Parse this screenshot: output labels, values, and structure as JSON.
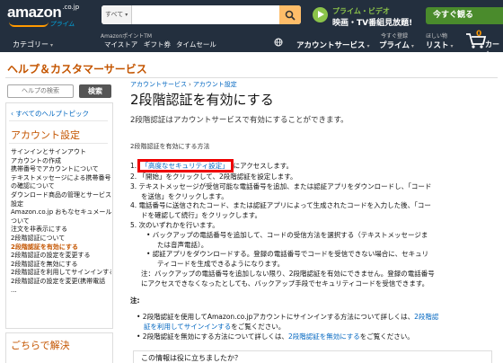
{
  "nav": {
    "logo_text": "amazon",
    "logo_suffix": ".co.jp",
    "logo_sub": "プライム",
    "search_dept": "すべて",
    "search_placeholder": "",
    "prime_video_top": "プライム・ビデオ",
    "prime_video_bottom": "映画・TV番組見放題!",
    "try_button": "今すぐ観る",
    "category_label": "カテゴリー",
    "pointcard_line": "AmazonポイントTM",
    "links": [
      "マイストア",
      "ギフト券",
      "タイムセール"
    ],
    "account_small": "",
    "account_label": "アカウントサービス",
    "prime_small": "今すぐ登録",
    "prime_label": "プライム",
    "list_small": "ほしい物",
    "list_label": "リスト",
    "cart_count": "0",
    "cart_label": "カート"
  },
  "help": {
    "title": "ヘルプ＆カスタマーサービス"
  },
  "sidebar": {
    "search_placeholder": "ヘルプの検索",
    "search_button": "検索",
    "all_help_link": "‹ すべてのヘルプトピック",
    "heading": "アカウント設定",
    "items": [
      {
        "label": "サインインとサインアウト",
        "active": false
      },
      {
        "label": "アカウントの作成",
        "active": false
      },
      {
        "label": "携帯番号でアカウントについて",
        "active": false
      },
      {
        "label": "テキストメッセージによる携帯番号",
        "active": false
      },
      {
        "label": "の確認について",
        "active": false
      },
      {
        "label": "ダウンロード商品の管理とサービス",
        "active": false
      },
      {
        "label": "設定",
        "active": false
      },
      {
        "label": "Amazon.co.jp おもなセキュメールに",
        "active": false
      },
      {
        "label": "ついて",
        "active": false
      },
      {
        "label": "注文を非表示にする",
        "active": false
      },
      {
        "label": "2段階認証について",
        "active": false
      },
      {
        "label": "2段階認証を有効にする",
        "active": true
      },
      {
        "label": "2段階認証の設定を変更する",
        "active": false
      },
      {
        "label": "2段階認証を無効にする",
        "active": false
      },
      {
        "label": "2段階認証を利用してサインインする",
        "active": false
      },
      {
        "label": "2段階認証の設定を変更(携帯電話",
        "active": false
      },
      {
        "label": "...",
        "active": false
      }
    ],
    "heading2": "ごちらで解決"
  },
  "main": {
    "breadcrumbs": [
      "アカウントサービス",
      "アカウント設定"
    ],
    "title": "2段階認証を有効にする",
    "intro": "2段階認証はアカウントサービスで有効にすることができます。",
    "steps_heading": "2段階認証を有効にする方法",
    "step1_pre": "1. ",
    "step1_link": "「高度なセキュリティ設定」",
    "step1_post": "にアクセスします。",
    "step2": "2. 「開始」をクリックして、2段階認証を設定します。",
    "step3a": "3. テキストメッセージが受信可能な電話番号を追加、または認証アプリをダウンロードし、「コード",
    "step3b": "を送信」をクリックします。",
    "step4a": "4. 電話番号に送信されたコード、または認証アプリによって生成されたコードを入力した後、「コー",
    "step4b": "ドを確認して続行」をクリックします。",
    "step5": "5. 次のいずれかを行います。",
    "bullet1a": "• バックアップの電話番号を追加して、コードの受信方法を選択する（テキストメッセージま",
    "bullet1b": "たは音声電話）。",
    "bullet2a": "• 認証アプリをダウンロードする。登録の電話番号でコードを受信できない場合に、セキュリ",
    "bullet2b": "ティコードを生成できるようになります。",
    "note_inline_a": "注：バックアップの電話番号を追加しない限り、2段階認証を有効にできません。登録の電話番号",
    "note_inline_b": "にアクセスできなくなったとしても、バックアップ手段でセキュリティコードを受信できます。",
    "note_label": "注:",
    "notes_1a_pre": "• 2段階認証を使用してAmazon.co.jpアカウントにサインインする方法について詳しくは、",
    "notes_1a_link": "2段階認",
    "notes_1b_link": "証を利用してサインインする",
    "notes_1b_post": "をご覧ください。",
    "notes_2_pre": "• 2段階認証を無効にする方法について詳しくは、",
    "notes_2_link": "2段階認証を無効にする",
    "notes_2_post": "をご覧ください。",
    "feedback": "この情報は役に立ちましたか？"
  },
  "colors": {
    "nav_bg": "#232f3e",
    "accent_orange": "#c45500",
    "link_blue": "#0066c0",
    "highlight_red": "#e00000",
    "prime_green": "#8bc34a"
  }
}
